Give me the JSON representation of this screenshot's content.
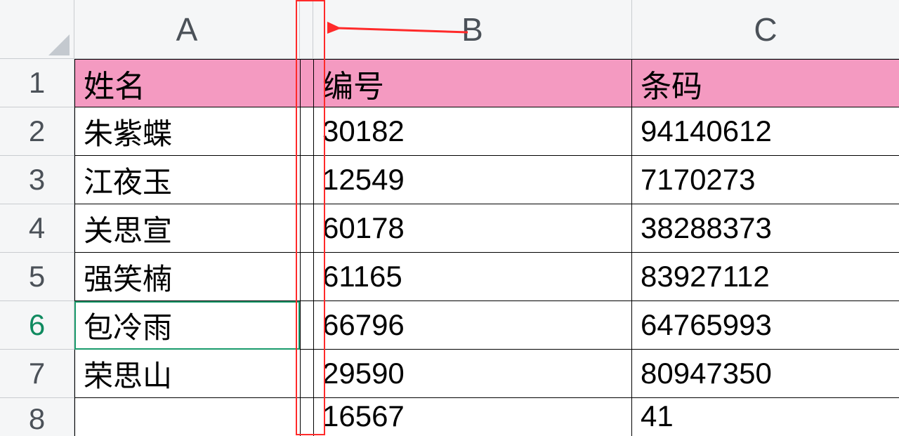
{
  "columns": {
    "A": "A",
    "B": "B",
    "C": "C"
  },
  "rowNumbers": [
    "1",
    "2",
    "3",
    "4",
    "5",
    "6",
    "7",
    "8"
  ],
  "activeRow": "6",
  "headers": {
    "A": "姓名",
    "B": "编号",
    "C": "条码"
  },
  "rows": [
    {
      "A": "朱紫蝶",
      "B": "30182",
      "C": "94140612"
    },
    {
      "A": "江夜玉",
      "B": "12549",
      "C": "7170273"
    },
    {
      "A": "关思宣",
      "B": "60178",
      "C": "38288373"
    },
    {
      "A": "强笑楠",
      "B": "61165",
      "C": "83927112"
    },
    {
      "A": "包冷雨",
      "B": "66796",
      "C": "64765993"
    },
    {
      "A": "荣思山",
      "B": "29590",
      "C": "80947350"
    }
  ],
  "row8_partial": {
    "B_prefix": "16567",
    "C_prefix": "41"
  },
  "chart_data": {
    "type": "table",
    "columns": [
      "姓名",
      "编号",
      "条码"
    ],
    "data": [
      [
        "朱紫蝶",
        30182,
        94140612
      ],
      [
        "江夜玉",
        12549,
        7170273
      ],
      [
        "关思宣",
        60178,
        38288373
      ],
      [
        "强笑楠",
        61165,
        83927112
      ],
      [
        "包冷雨",
        66796,
        64765993
      ],
      [
        "荣思山",
        29590,
        80947350
      ]
    ],
    "note": "Row 8 is cut off; visible partial values: 编号≈16567, 条码 starts with 41"
  },
  "annotation": {
    "type": "callout",
    "target": "narrow-column-between-A-and-B",
    "color": "#ff2a2a"
  },
  "colors": {
    "headerFill": "#f49ac1",
    "activeGreen": "#1a9b6c",
    "annotationRed": "#ff2a2a"
  }
}
